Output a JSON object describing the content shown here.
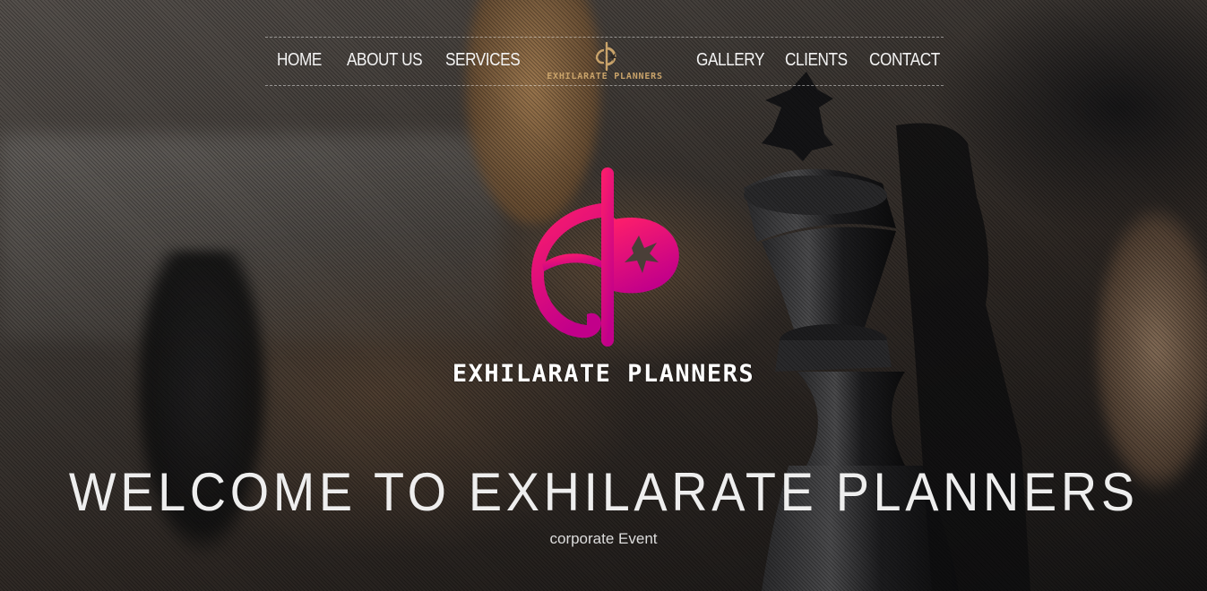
{
  "nav": {
    "items": [
      {
        "label": "HOME"
      },
      {
        "label": "ABOUT US"
      },
      {
        "label": "SERVICES"
      },
      {
        "label": "GALLERY"
      },
      {
        "label": "CLIENTS"
      },
      {
        "label": "CONTACT"
      }
    ],
    "logo_text": "EXHILARATE PLANNERS",
    "logo_color": "#c9a36a"
  },
  "hero": {
    "brand_name": "EXHILARATE PLANNERS",
    "heading": "WELCOME TO EXHILARATE PLANNERS",
    "subtitle": "corporate Event",
    "logo_icon": "ep-monogram-icon",
    "logo_gradient": [
      "#ff1f6a",
      "#c2008a"
    ],
    "background": "blurred chess board photo"
  }
}
